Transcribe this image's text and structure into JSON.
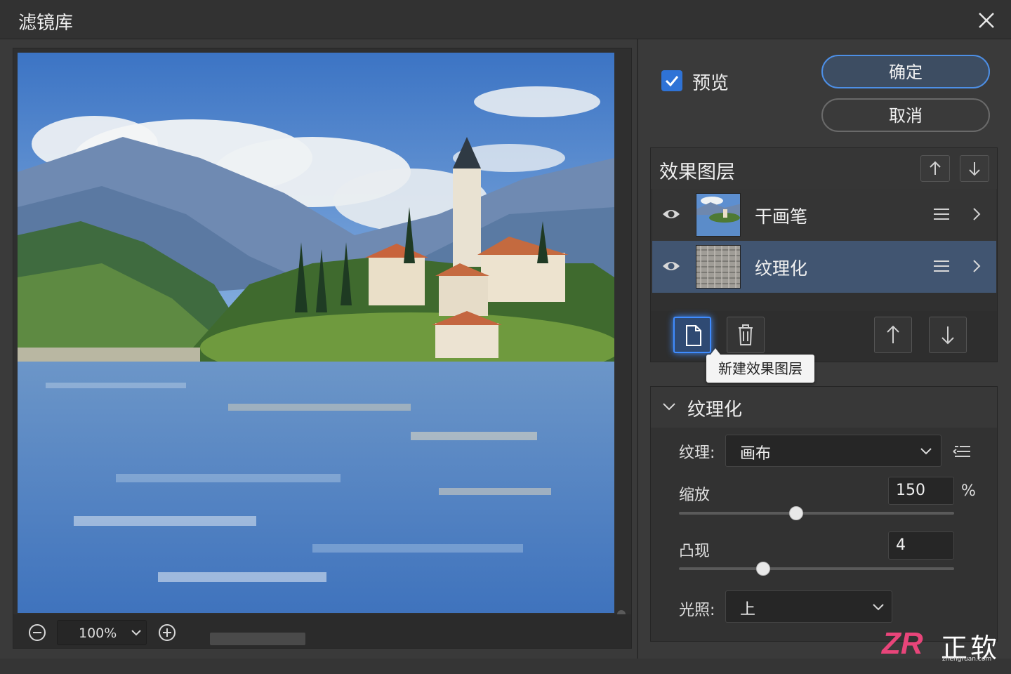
{
  "window": {
    "title": "滤镜库"
  },
  "zoom": {
    "value": "100%"
  },
  "preview": {
    "label": "预览",
    "checked": true
  },
  "buttons": {
    "ok": "确定",
    "cancel": "取消"
  },
  "layers": {
    "title": "效果图层",
    "items": [
      {
        "name": "干画笔",
        "visible": true,
        "selected": false
      },
      {
        "name": "纹理化",
        "visible": true,
        "selected": true
      }
    ],
    "tooltip": "新建效果图层"
  },
  "filter": {
    "title": "纹理化",
    "texture_label": "纹理:",
    "texture_value": "画布",
    "scale_label": "缩放",
    "scale_value": "150",
    "scale_unit": "%",
    "relief_label": "凸现",
    "relief_value": "4",
    "light_label": "光照:",
    "light_value": "上"
  },
  "watermark": {
    "logo": "ZR",
    "name": "正软",
    "url": "zhengruan.com"
  },
  "colors": {
    "accent": "#3f8cff",
    "selected_row": "#415571",
    "watermark": "#e8457a"
  }
}
